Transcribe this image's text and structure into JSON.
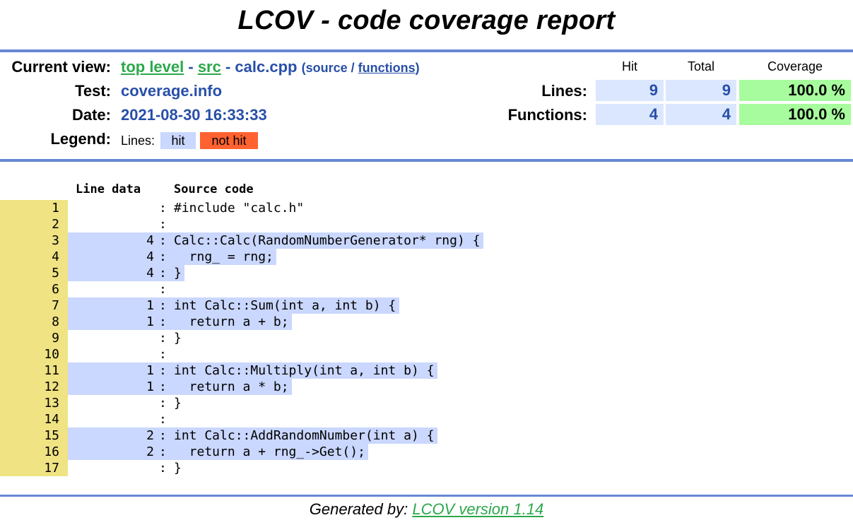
{
  "title": "LCOV - code coverage report",
  "header": {
    "current_view_label": "Current view:",
    "crumb_top": "top level",
    "crumb_sep1": " - ",
    "crumb_src": "src",
    "crumb_sep2": " - ",
    "crumb_file": "calc.cpp",
    "view_open": "(",
    "view_source": "source",
    "view_slash": " / ",
    "view_functions": "functions",
    "view_close": ")",
    "test_label": "Test:",
    "test_value": "coverage.info",
    "date_label": "Date:",
    "date_value": "2021-08-30 16:33:33",
    "legend_label": "Legend:",
    "legend_lines": "Lines:",
    "legend_hit": "hit",
    "legend_not_hit": "not hit"
  },
  "summary": {
    "col_hit": "Hit",
    "col_total": "Total",
    "col_coverage": "Coverage",
    "rows": [
      {
        "label": "Lines:",
        "hit": "9",
        "total": "9",
        "coverage": "100.0 %"
      },
      {
        "label": "Functions:",
        "hit": "4",
        "total": "4",
        "coverage": "100.0 %"
      }
    ]
  },
  "source": {
    "col_line_data": "Line data",
    "col_source_code": "Source code",
    "lines": [
      {
        "num": "1",
        "count": "",
        "code": "#include \"calc.h\""
      },
      {
        "num": "2",
        "count": "",
        "code": ""
      },
      {
        "num": "3",
        "count": "4",
        "code": "Calc::Calc(RandomNumberGenerator* rng) {"
      },
      {
        "num": "4",
        "count": "4",
        "code": "  rng_ = rng;"
      },
      {
        "num": "5",
        "count": "4",
        "code": "}"
      },
      {
        "num": "6",
        "count": "",
        "code": ""
      },
      {
        "num": "7",
        "count": "1",
        "code": "int Calc::Sum(int a, int b) {"
      },
      {
        "num": "8",
        "count": "1",
        "code": "  return a + b;"
      },
      {
        "num": "9",
        "count": "",
        "code": "}"
      },
      {
        "num": "10",
        "count": "",
        "code": ""
      },
      {
        "num": "11",
        "count": "1",
        "code": "int Calc::Multiply(int a, int b) {"
      },
      {
        "num": "12",
        "count": "1",
        "code": "  return a * b;"
      },
      {
        "num": "13",
        "count": "",
        "code": "}"
      },
      {
        "num": "14",
        "count": "",
        "code": ""
      },
      {
        "num": "15",
        "count": "2",
        "code": "int Calc::AddRandomNumber(int a) {"
      },
      {
        "num": "16",
        "count": "2",
        "code": "  return a + rng_->Get();"
      },
      {
        "num": "17",
        "count": "",
        "code": "}"
      }
    ]
  },
  "footer": {
    "prefix": "Generated by: ",
    "link": "LCOV version 1.14"
  },
  "colors": {
    "rule": "#6688d4",
    "hit": "#cad7fe",
    "not_hit": "#ff6230",
    "line_num": "#efe383",
    "coverage_high": "#a7fc9d",
    "link": "#2ca84c"
  }
}
